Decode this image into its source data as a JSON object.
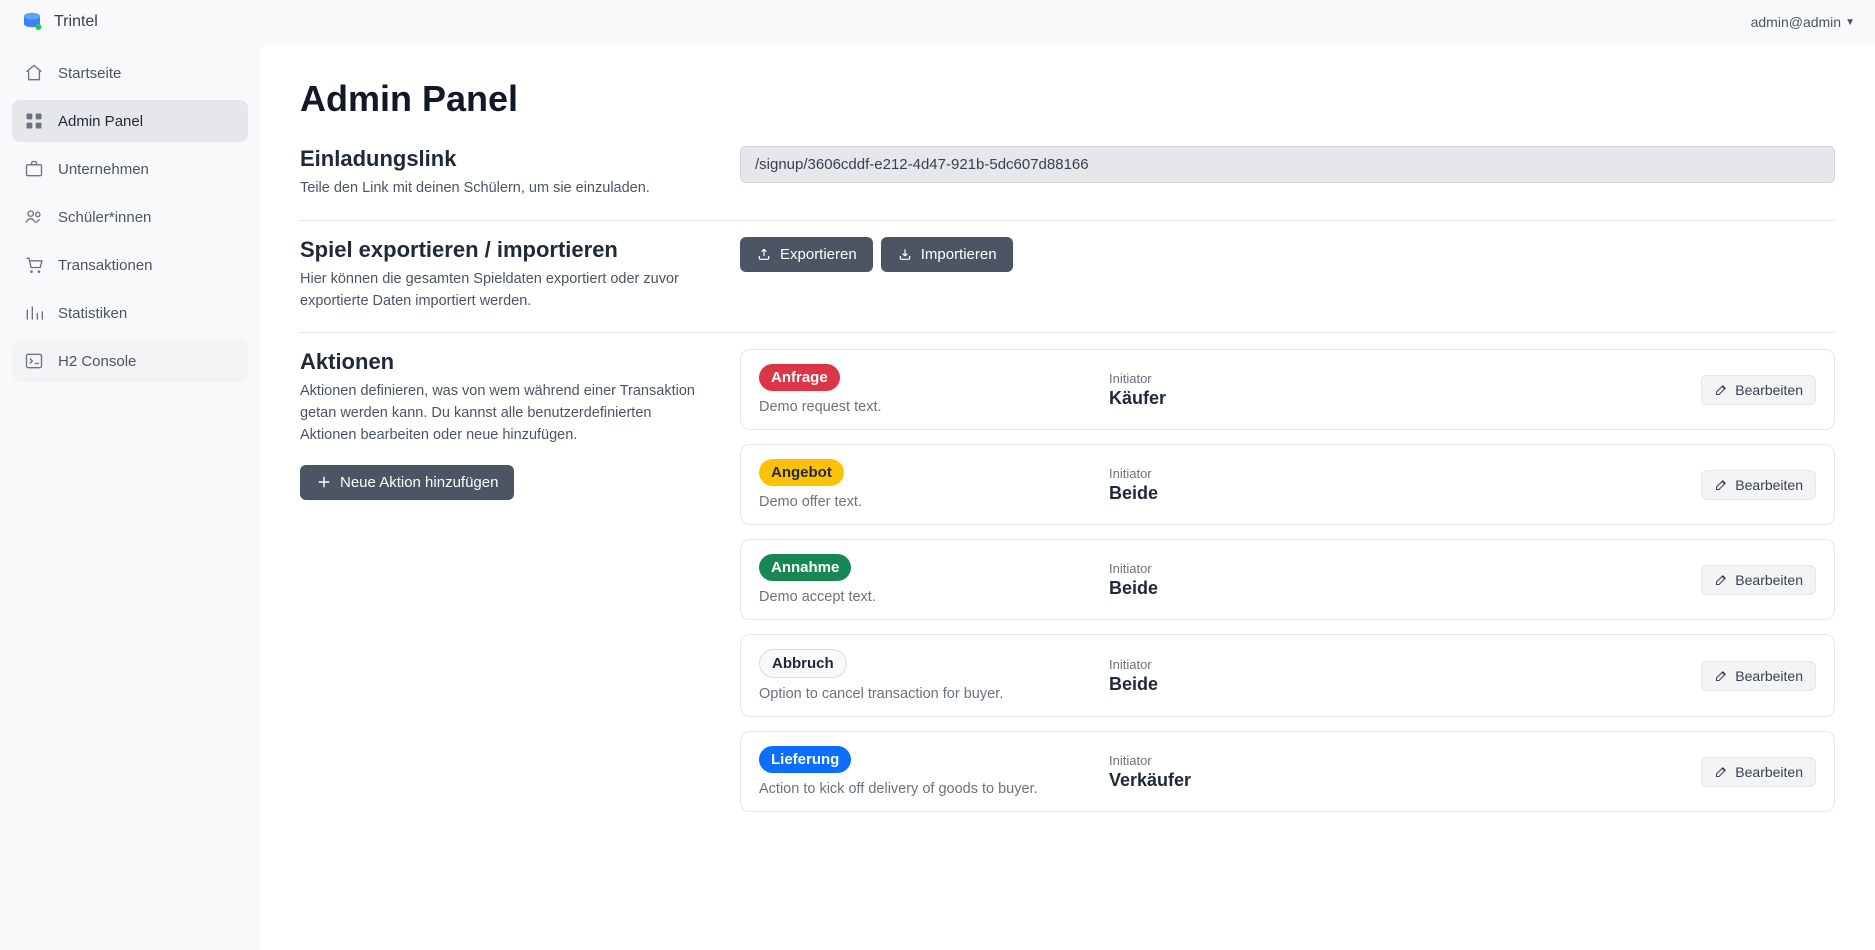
{
  "brand": "Trintel",
  "user": "admin@admin",
  "sidebar": {
    "items": [
      {
        "icon": "home",
        "label": "Startseite"
      },
      {
        "icon": "grid",
        "label": "Admin Panel",
        "active": true
      },
      {
        "icon": "briefcase",
        "label": "Unternehmen"
      },
      {
        "icon": "users",
        "label": "Schüler*innen"
      },
      {
        "icon": "cart",
        "label": "Transaktionen"
      },
      {
        "icon": "bars",
        "label": "Statistiken"
      },
      {
        "icon": "terminal",
        "label": "H2 Console",
        "special": true
      }
    ]
  },
  "page_title": "Admin Panel",
  "invite": {
    "title": "Einladungslink",
    "desc": "Teile den Link mit deinen Schülern, um sie einzuladen.",
    "value": "/signup/3606cddf-e212-4d47-921b-5dc607d88166"
  },
  "export": {
    "title": "Spiel exportieren / importieren",
    "desc": "Hier können die gesamten Spieldaten exportiert oder zuvor exportierte Daten importiert werden.",
    "export_label": "Exportieren",
    "import_label": "Importieren"
  },
  "actions": {
    "title": "Aktionen",
    "desc": "Aktionen definieren, was von wem während einer Transaktion getan werden kann. Du kannst alle benutzerdefinierten Aktionen bearbeiten oder neue hinzufügen.",
    "add_label": "Neue Aktion hinzufügen",
    "edit_label": "Bearbeiten",
    "initiator_label": "Initiator",
    "list": [
      {
        "badge": "Anfrage",
        "color": "red",
        "text": "Demo request text.",
        "initiator": "Käufer"
      },
      {
        "badge": "Angebot",
        "color": "yellow",
        "text": "Demo offer text.",
        "initiator": "Beide"
      },
      {
        "badge": "Annahme",
        "color": "green",
        "text": "Demo accept text.",
        "initiator": "Beide"
      },
      {
        "badge": "Abbruch",
        "color": "light",
        "text": "Option to cancel transaction for buyer.",
        "initiator": "Beide"
      },
      {
        "badge": "Lieferung",
        "color": "blue",
        "text": "Action to kick off delivery of goods to buyer.",
        "initiator": "Verkäufer"
      }
    ]
  }
}
